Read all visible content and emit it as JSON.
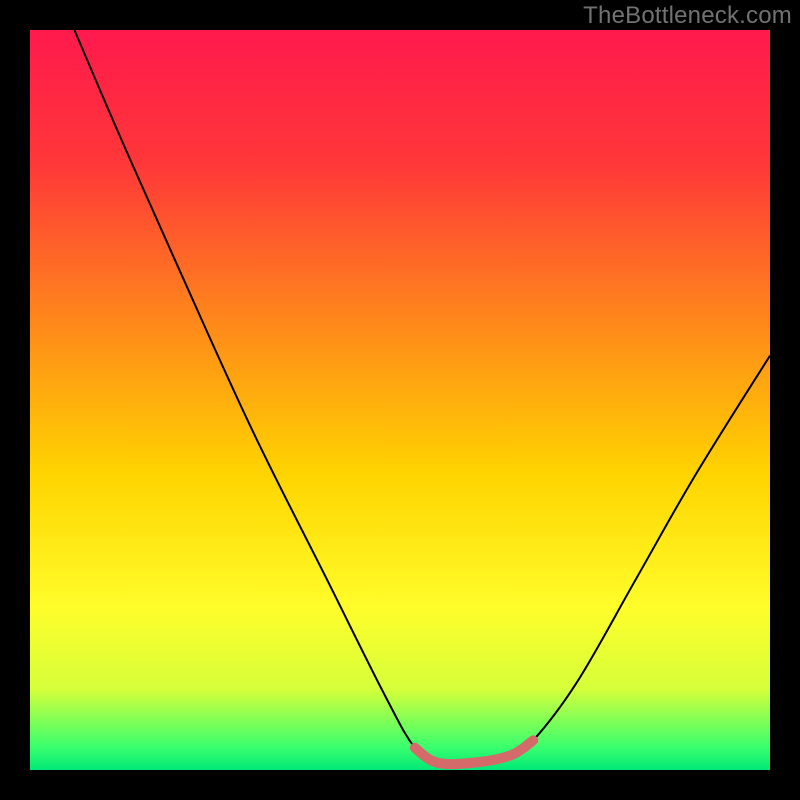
{
  "watermark": "TheBottleneck.com",
  "chart_data": {
    "type": "line",
    "title": "",
    "xlabel": "",
    "ylabel": "",
    "xlim": [
      0,
      100
    ],
    "ylim": [
      0,
      100
    ],
    "background_gradient": {
      "orientation": "vertical",
      "stops": [
        {
          "pos": 0.0,
          "color": "#ff1a4d"
        },
        {
          "pos": 0.18,
          "color": "#ff3739"
        },
        {
          "pos": 0.4,
          "color": "#ff8a1a"
        },
        {
          "pos": 0.6,
          "color": "#ffd400"
        },
        {
          "pos": 0.78,
          "color": "#fffd2a"
        },
        {
          "pos": 0.89,
          "color": "#d6ff3a"
        },
        {
          "pos": 0.97,
          "color": "#38ff6e"
        },
        {
          "pos": 1.0,
          "color": "#00e877"
        }
      ]
    },
    "series": [
      {
        "name": "main-curve",
        "color": "#000000",
        "stroke_width": 2,
        "points": [
          {
            "x": 6,
            "y": 100
          },
          {
            "x": 12,
            "y": 86
          },
          {
            "x": 20,
            "y": 68
          },
          {
            "x": 30,
            "y": 46
          },
          {
            "x": 40,
            "y": 26
          },
          {
            "x": 48,
            "y": 10
          },
          {
            "x": 52,
            "y": 3
          },
          {
            "x": 55,
            "y": 1
          },
          {
            "x": 60,
            "y": 1
          },
          {
            "x": 65,
            "y": 2
          },
          {
            "x": 68,
            "y": 4
          },
          {
            "x": 74,
            "y": 12
          },
          {
            "x": 82,
            "y": 26
          },
          {
            "x": 90,
            "y": 40
          },
          {
            "x": 100,
            "y": 56
          }
        ]
      },
      {
        "name": "highlight-band",
        "color": "#d46a6a",
        "stroke_width": 10,
        "points": [
          {
            "x": 52,
            "y": 3
          },
          {
            "x": 55,
            "y": 1
          },
          {
            "x": 60,
            "y": 1
          },
          {
            "x": 65,
            "y": 2
          },
          {
            "x": 68,
            "y": 4
          }
        ]
      }
    ]
  }
}
